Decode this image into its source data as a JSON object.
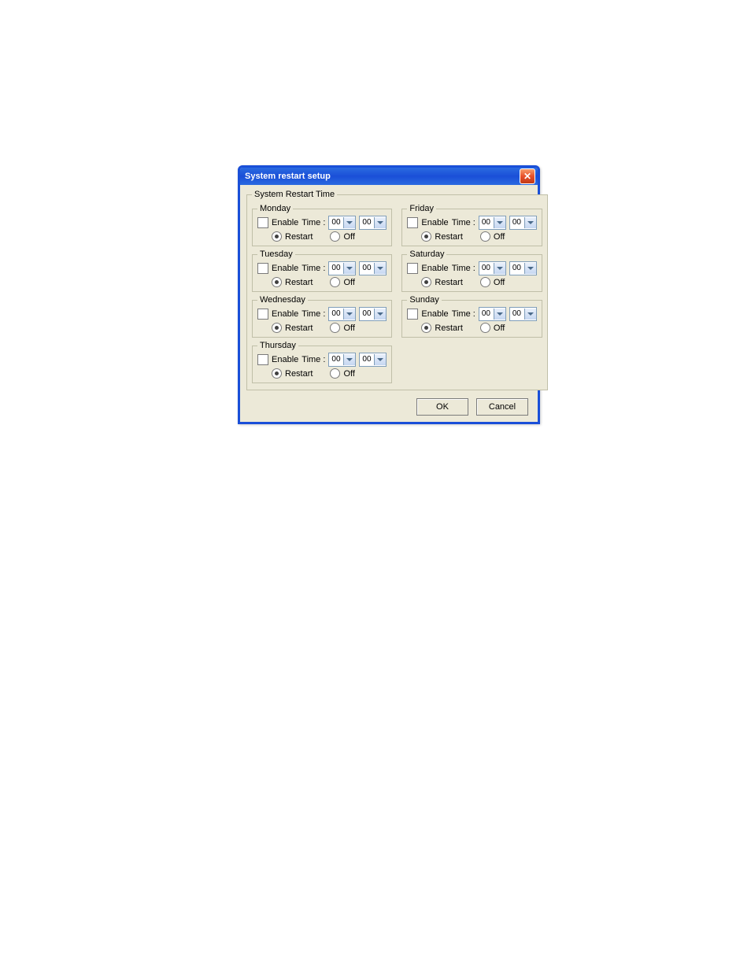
{
  "window": {
    "title": "System restart setup"
  },
  "group": {
    "legend": "System Restart Time"
  },
  "labels": {
    "enable": "Enable",
    "time": "Time :",
    "restart": "Restart",
    "off": "Off",
    "ok": "OK",
    "cancel": "Cancel"
  },
  "days": {
    "monday": {
      "legend": "Monday",
      "enabled": false,
      "hour": "00",
      "minute": "00",
      "mode": "restart"
    },
    "tuesday": {
      "legend": "Tuesday",
      "enabled": false,
      "hour": "00",
      "minute": "00",
      "mode": "restart"
    },
    "wednesday": {
      "legend": "Wednesday",
      "enabled": false,
      "hour": "00",
      "minute": "00",
      "mode": "restart"
    },
    "thursday": {
      "legend": "Thursday",
      "enabled": false,
      "hour": "00",
      "minute": "00",
      "mode": "restart"
    },
    "friday": {
      "legend": "Friday",
      "enabled": false,
      "hour": "00",
      "minute": "00",
      "mode": "restart"
    },
    "saturday": {
      "legend": "Saturday",
      "enabled": false,
      "hour": "00",
      "minute": "00",
      "mode": "restart"
    },
    "sunday": {
      "legend": "Sunday",
      "enabled": false,
      "hour": "00",
      "minute": "00",
      "mode": "restart"
    }
  }
}
